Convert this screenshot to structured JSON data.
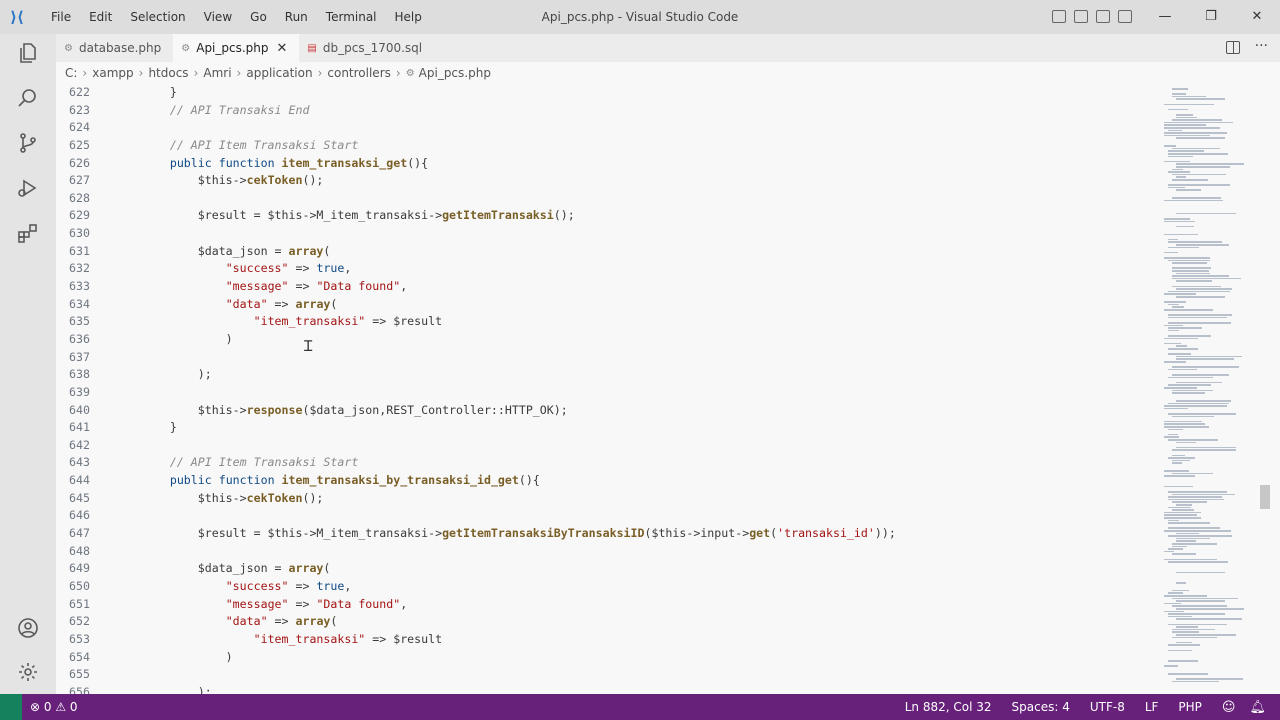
{
  "window": {
    "title": "Api_pcs.php - Visual Studio Code",
    "menu": [
      "File",
      "Edit",
      "Selection",
      "View",
      "Go",
      "Run",
      "Terminal",
      "Help"
    ],
    "controls": [
      "—",
      "❐",
      "✕"
    ]
  },
  "tabs": [
    {
      "label": "database.php",
      "icon": "php-file-icon",
      "active": false
    },
    {
      "label": "Api_pcs.php",
      "icon": "php-file-icon",
      "active": true,
      "close": "✕"
    },
    {
      "label": "db_pcs_1700.sql",
      "icon": "database-file-icon",
      "active": false
    }
  ],
  "breadcrumb": [
    "C:",
    "xampp",
    "htdocs",
    "Amri",
    "application",
    "controllers",
    "Api_pcs.php"
  ],
  "editor": {
    "lines": [
      {
        "n": 622,
        "t": "        }"
      },
      {
        "n": 623,
        "t": "        // API Transaksi End"
      },
      {
        "n": 624,
        "t": ""
      },
      {
        "n": 625,
        "t": "        // API Item Transaksi Start"
      },
      {
        "n": 626,
        "t": "        public function item_transaksi_get(){"
      },
      {
        "n": 627,
        "t": "            $this->cekToken();"
      },
      {
        "n": 628,
        "t": ""
      },
      {
        "n": 629,
        "t": "            $result = $this->M_item_transaksi->getItemTransaksi();"
      },
      {
        "n": 630,
        "t": ""
      },
      {
        "n": 631,
        "t": "            $data_json = array("
      },
      {
        "n": 632,
        "t": "                \"success\" => true,"
      },
      {
        "n": 633,
        "t": "                \"message\" => \"Data found\","
      },
      {
        "n": 634,
        "t": "                \"data\" => array("
      },
      {
        "n": 635,
        "t": "                    \"item_transaksi\" => $result"
      },
      {
        "n": 636,
        "t": "                )"
      },
      {
        "n": 637,
        "t": ""
      },
      {
        "n": 638,
        "t": "            );"
      },
      {
        "n": 639,
        "t": ""
      },
      {
        "n": 640,
        "t": "            $this->response($data_json,REST_Controller::HTTP_OK);"
      },
      {
        "n": 641,
        "t": "        }"
      },
      {
        "n": 642,
        "t": ""
      },
      {
        "n": 643,
        "t": "        // API Item Transaksi Start"
      },
      {
        "n": 644,
        "t": "        public function item_transaksi_by_transaksi_id_get(){"
      },
      {
        "n": 645,
        "t": "            $this->cekToken();"
      },
      {
        "n": 646,
        "t": ""
      },
      {
        "n": 647,
        "t": "            $result = $this->M_item_transaksi->getItemTransaksiByTransaksiID($this->input->get('transaksi_id'));"
      },
      {
        "n": 648,
        "t": ""
      },
      {
        "n": 649,
        "t": "            $data_json = array("
      },
      {
        "n": 650,
        "t": "                \"success\" => true,"
      },
      {
        "n": 651,
        "t": "                \"message\" => \"Data found\","
      },
      {
        "n": 652,
        "t": "                \"data\" => array("
      },
      {
        "n": 653,
        "t": "                    \"item_transaksi\" => $result"
      },
      {
        "n": 654,
        "t": "                )"
      },
      {
        "n": 655,
        "t": ""
      },
      {
        "n": 656,
        "t": "            );"
      }
    ]
  },
  "statusbar": {
    "problems": "⊗ 0 ⚠ 0",
    "position": "Ln 882, Col 32",
    "spaces": "Spaces: 4",
    "encoding": "UTF-8",
    "eol": "LF",
    "language": "PHP",
    "colors": {
      "background": "#68217a",
      "remote": "#16825d"
    }
  }
}
